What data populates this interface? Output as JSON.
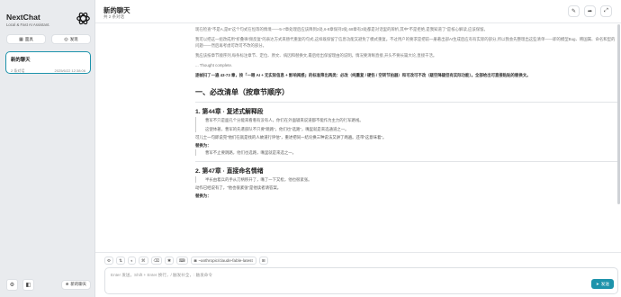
{
  "sidebar": {
    "app_title": "NextChat",
    "app_subtitle": "Local & Fast AI Assistant.",
    "mask_label": "面具",
    "discover_label": "发现",
    "chat": {
      "title": "新的聊天",
      "count": "2 条对话",
      "time": "2025/6/22 12:38:06"
    },
    "new_chat_label": "新的聊天"
  },
  "header": {
    "title": "新的聊天",
    "subtitle": "共 2 条对话"
  },
  "content": {
    "intro1": "现在检查“不是A,是B”这个句式在恒等的情境——5-7章处理后应该降到2处,6-8章保持2处,68章有3处都是对话里的辨析,其中“不是拒绝,是我知道了”是核心解读,应该保留。",
    "intro2": "我可以把这一组改成用“折叠律/频反复”的表达方式来替代重复的句式,这样既保留了信息功能又避免了模式重复。不过用户的要求是把前一册著出部AI生成后应有有实际的部分,所以我会先整理出这些清单——即的模型Bug、韩国属、命名和型的问题——然后再考虑可改可不改的部分。",
    "intro3": "我应该按章节顺序列,每条标注章节、定位、原文、病因和替换文,最后给出保留理由的说明。情况要清晰直接,开头不要长篇大论,直接干活。",
    "thought": "... Thought complete.",
    "summary": "逐帧扫了一遍 43-73 章，按「一眼 AI + 无实际信息 + 影响阅感」的标准筛出两类：必改（纯重复 / 硬伤 / 空转节拍器）和可改可不改（疑空降疑但有实际功能）。全部给出可直接粘贴的替换文。",
    "section_title": "一、必改清单（按章节顺序）",
    "items": [
      {
        "title": "1. 第44章 · 复述式解释段",
        "quote1": "曹军不只是面孔个分能来看看有没有人，你们在外面辍来说道都不能作为主力的行军路线。",
        "quote2": "这使体著，曹军的先遣部队不只要“跳路”，他们也“选路”，嘴里就是来选通道之一。",
        "note": "可儿士一句即说完“他们在就是找的人故道行评估”，重述把同一结论换三种说法又讲了两遍。还带“这意味着”。",
        "label": "替换为：",
        "replacement": "曹军不止要跳路，他们也选路，嘴里就是来选之一。"
      },
      {
        "title": "2. 第47章 · 直接命名情绪",
        "quote1": "半长由着兵的手从刀柄移开了，嘴了一下又松，他也很紧张。",
        "note": "动作已经说有了，“他也很紧张”是他读者请答案。",
        "label": "替换为：",
        "replacement": ""
      }
    ]
  },
  "input": {
    "model_label": "~anthropic/claude-fable-latest",
    "placeholder": "Enter 发送，Shift + Enter 换行，/ 触发补全，: 触发命令",
    "send_label": "发送"
  },
  "colors": {
    "accent": "#1d93ab"
  }
}
